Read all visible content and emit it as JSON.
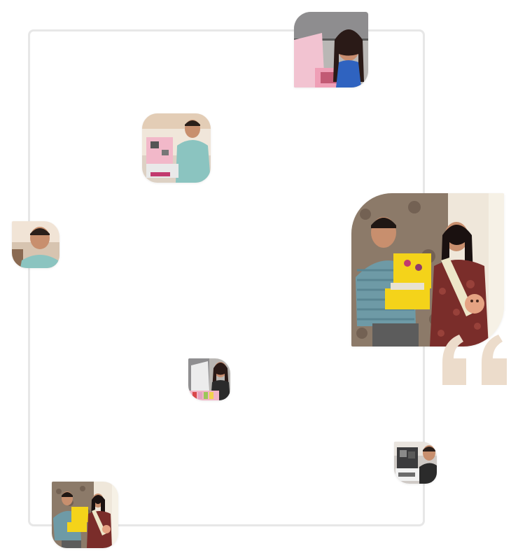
{
  "section": {
    "frame": "testimonial-frame",
    "accent_color": "#ecdccb",
    "border_color": "#e7e7e7"
  },
  "photos": [
    {
      "name": "customer-photo-woman-pink-box",
      "icon": "photo-icon"
    },
    {
      "name": "customer-photo-man-pink-box",
      "icon": "photo-icon"
    },
    {
      "name": "customer-photo-man-portrait",
      "icon": "photo-icon"
    },
    {
      "name": "customer-photo-couple-yellow-box",
      "icon": "photo-icon"
    },
    {
      "name": "customer-photo-woman-gift-box-small",
      "icon": "photo-icon"
    },
    {
      "name": "customer-photo-man-gift-box-small",
      "icon": "photo-icon"
    },
    {
      "name": "customer-photo-couple-yellow-box-small",
      "icon": "photo-icon"
    }
  ],
  "quote_icon": "quote-mark-icon"
}
